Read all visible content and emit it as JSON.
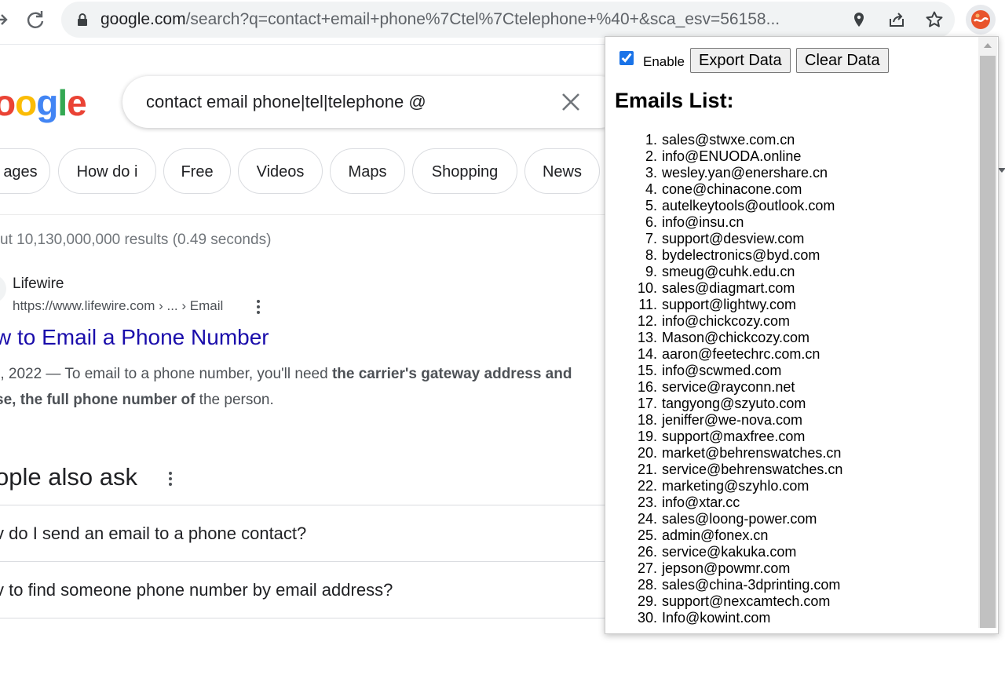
{
  "browser": {
    "url_main": "google.com",
    "url_rest": "/search?q=contact+email+phone%7Ctel%7Ctelephone+%40+&sca_esv=56158..."
  },
  "google": {
    "logo_text": "oogle",
    "query": "contact email phone|tel|telephone @",
    "chips": [
      "ages",
      "How do i",
      "Free",
      "Videos",
      "Maps",
      "Shopping",
      "News"
    ],
    "stats": "ut 10,130,000,000 results (0.49 seconds)",
    "result": {
      "site_name": "Lifewire",
      "site_url": "https://www.lifewire.com › ... › Email",
      "title": "w to Email a Phone Number",
      "snippet_line1_prefix": "), 2022 — To email to a phone number, you'll need ",
      "snippet_line1_bold": "the carrier's gateway address and",
      "snippet_line2_bold": "se, the full phone number of",
      "snippet_line2_suffix": " the person."
    },
    "people_also_ask": {
      "title": "ople also ask",
      "questions": [
        "v do I send an email to a phone contact?",
        "v to find someone phone number by email address?"
      ]
    }
  },
  "popup": {
    "enable_label": "Enable",
    "enabled": true,
    "export_label": "Export Data",
    "clear_label": "Clear Data",
    "heading": "Emails List:",
    "emails": [
      "sales@stwxe.com.cn",
      "info@ENUODA.online",
      "wesley.yan@enershare.cn",
      "cone@chinacone.com",
      "autelkeytools@outlook.com",
      "info@insu.cn",
      "support@desview.com",
      "bydelectronics@byd.com",
      "smeug@cuhk.edu.cn",
      "sales@diagmart.com",
      "support@lightwy.com",
      "info@chickcozy.com",
      "Mason@chickcozy.com",
      "aaron@feetechrc.com.cn",
      "info@scwmed.com",
      "service@rayconn.net",
      "tangyong@szyuto.com",
      "jeniffer@we-nova.com",
      "support@maxfree.com",
      "market@behrenswatches.cn",
      "service@behrenswatches.cn",
      "marketing@szyhlo.com",
      "info@xtar.cc",
      "sales@loong-power.com",
      "admin@fonex.cn",
      "service@kakuka.com",
      "jepson@powmr.com",
      "sales@china-3dprinting.com",
      "support@nexcamtech.com",
      "Info@kowint.com"
    ]
  }
}
